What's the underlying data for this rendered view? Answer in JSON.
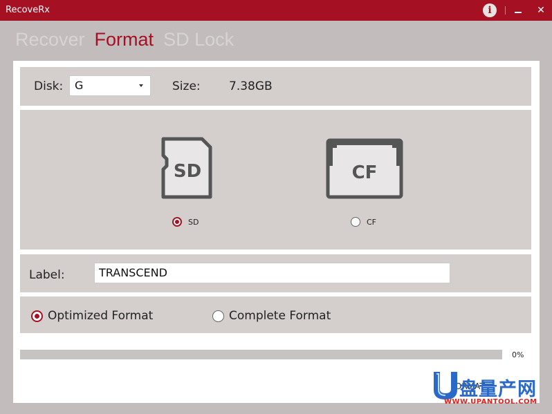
{
  "window": {
    "title": "RecoveRx"
  },
  "titlebar_icons": {
    "info": "info-icon",
    "minimize": "minimize-icon",
    "close": "close-icon"
  },
  "tabs": [
    {
      "label": "Recover",
      "active": false
    },
    {
      "label": "Format",
      "active": true
    },
    {
      "label": "SD Lock",
      "active": false
    }
  ],
  "disk": {
    "label": "Disk:",
    "selected": "G",
    "size_label": "Size:",
    "size_value": "7.38GB"
  },
  "card_type": {
    "options": [
      {
        "icon_text": "SD",
        "label": "SD",
        "selected": true
      },
      {
        "icon_text": "CF",
        "label": "CF",
        "selected": false
      }
    ]
  },
  "volume_label": {
    "label": "Label:",
    "value": "TRANSCEND"
  },
  "format_mode": {
    "options": [
      {
        "label": "Optimized Format",
        "selected": true
      },
      {
        "label": "Complete Format",
        "selected": false
      }
    ]
  },
  "progress": {
    "text": "0%",
    "value": 0
  },
  "format_button": {
    "label": "FORMAT"
  },
  "watermark": {
    "text": "盘量产网",
    "url": "WWW.UPANTOOL.COM"
  },
  "colors": {
    "accent": "#a51022",
    "panel": "#d4cecd",
    "background": "#c2bcbc",
    "watermark_blue": "#2b69c9",
    "watermark_red": "#e3211c"
  }
}
